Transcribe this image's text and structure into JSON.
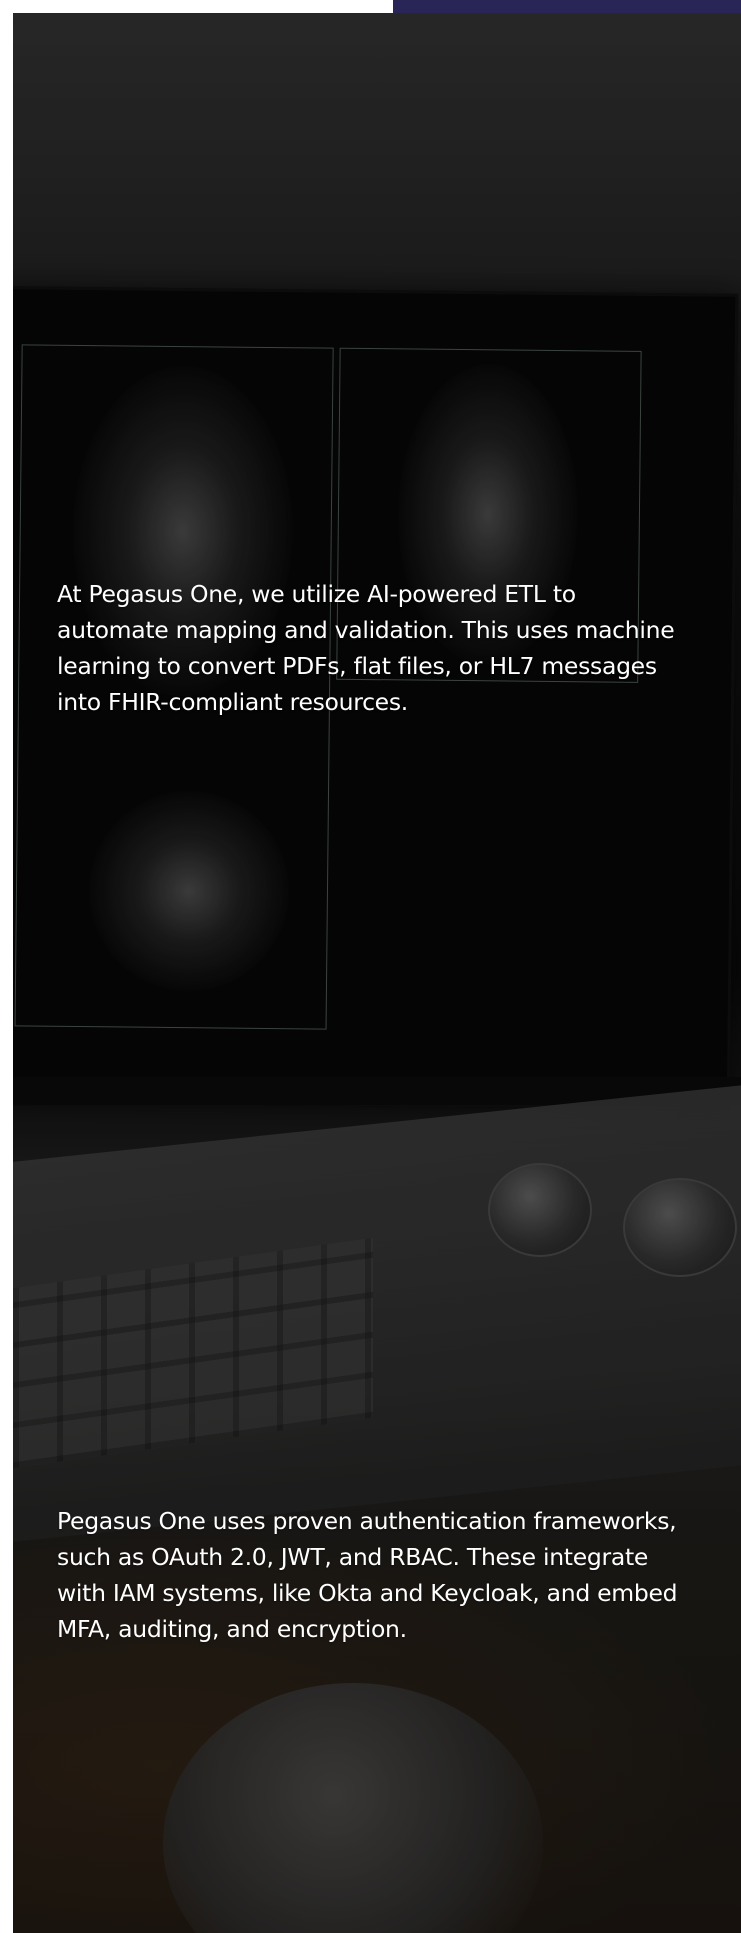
{
  "colors": {
    "accent_bar": "#2a2557",
    "text": "#ffffff"
  },
  "background": {
    "image_subject": "medical-imaging-workstation-photo"
  },
  "sections": [
    {
      "paragraph": "At Pegasus One, we utilize AI-powered ETL to automate mapping and validation. This uses machine learning to convert PDFs, flat files, or HL7 messages into FHIR-compliant resources."
    },
    {
      "paragraph": "Pegasus One uses proven authentication frameworks, such as OAuth 2.0, JWT, and RBAC. These integrate with IAM systems, like Okta and Keycloak, and embed MFA, auditing, and encryption."
    }
  ]
}
